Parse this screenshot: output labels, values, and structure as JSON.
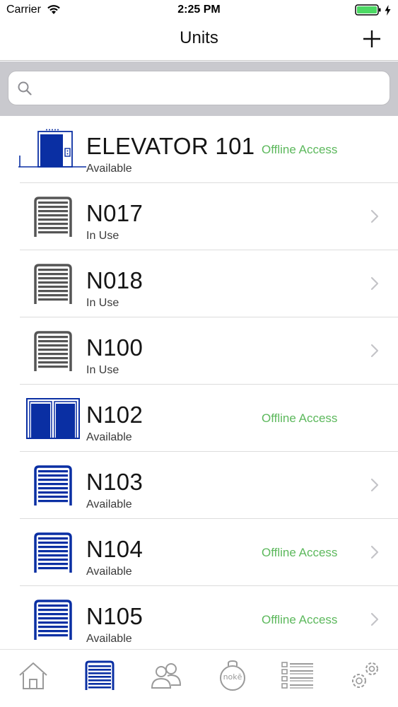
{
  "status_bar": {
    "carrier": "Carrier",
    "time": "2:25 PM"
  },
  "nav": {
    "title": "Units",
    "add_icon": "plus-icon"
  },
  "search": {
    "placeholder": "",
    "value": ""
  },
  "units": [
    {
      "name": "ELEVATOR 101",
      "status": "Available",
      "offline": "Offline Access",
      "icon": "elevator-icon",
      "chevron": false
    },
    {
      "name": "N017",
      "status": "In Use",
      "offline": "",
      "icon": "storage-door-icon",
      "chevron": true
    },
    {
      "name": "N018",
      "status": "In Use",
      "offline": "",
      "icon": "storage-door-icon",
      "chevron": true
    },
    {
      "name": "N100",
      "status": "In Use",
      "offline": "",
      "icon": "storage-door-icon",
      "chevron": true
    },
    {
      "name": "N102",
      "status": "Available",
      "offline": "Offline Access",
      "icon": "double-door-icon",
      "chevron": false
    },
    {
      "name": "N103",
      "status": "Available",
      "offline": "",
      "icon": "storage-door-icon",
      "chevron": true
    },
    {
      "name": "N104",
      "status": "Available",
      "offline": "Offline Access",
      "icon": "storage-door-icon",
      "chevron": true
    },
    {
      "name": "N105",
      "status": "Available",
      "offline": "Offline Access",
      "icon": "storage-door-icon",
      "chevron": true
    }
  ],
  "tabs": [
    {
      "name": "home",
      "icon": "home-icon",
      "active": false
    },
    {
      "name": "units",
      "icon": "unit-door-icon",
      "active": true
    },
    {
      "name": "users",
      "icon": "users-icon",
      "active": false
    },
    {
      "name": "noke",
      "icon": "noke-lock-icon",
      "active": false,
      "label": "nokē"
    },
    {
      "name": "list",
      "icon": "list-icon",
      "active": false
    },
    {
      "name": "settings",
      "icon": "gears-icon",
      "active": false
    }
  ],
  "colors": {
    "accent_blue": "#0a2fa3",
    "in_use_gray": "#555555",
    "offline_green": "#5cb85c",
    "tab_inactive": "#9a9a9a",
    "battery_green": "#4cd964"
  }
}
